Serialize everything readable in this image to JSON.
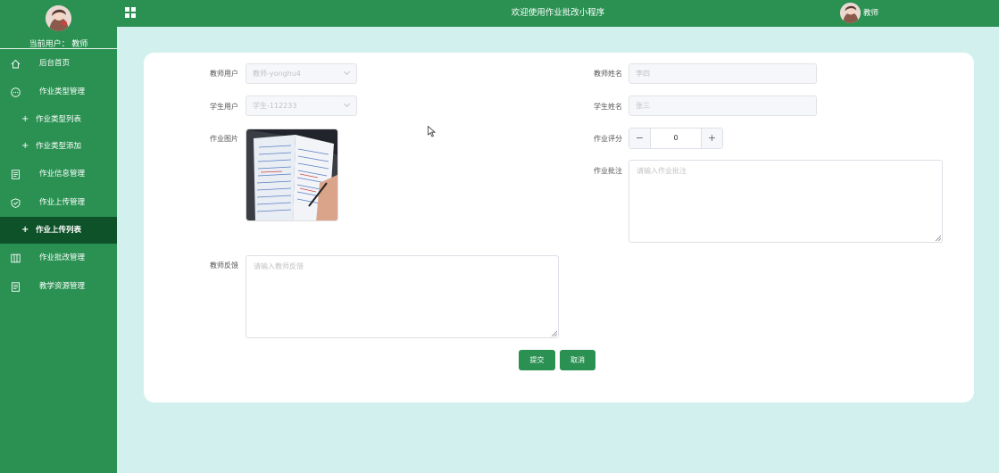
{
  "sidebar": {
    "user_label": "当前用户：  教师",
    "menu": [
      {
        "label": "后台首页",
        "icon": "home-icon",
        "type": "top"
      },
      {
        "label": "作业类型管理",
        "icon": "chat-icon",
        "type": "top"
      },
      {
        "label": "作业类型列表",
        "icon": "plus-icon",
        "type": "sub"
      },
      {
        "label": "作业类型添加",
        "icon": "plus-icon",
        "type": "sub"
      },
      {
        "label": "作业信息管理",
        "icon": "document-icon",
        "type": "top"
      },
      {
        "label": "作业上传管理",
        "icon": "shield-icon",
        "type": "top"
      },
      {
        "label": "作业上传列表",
        "icon": "plus-icon",
        "type": "sub",
        "active": true
      },
      {
        "label": "作业批改管理",
        "icon": "columns-icon",
        "type": "top"
      },
      {
        "label": "教学资源管理",
        "icon": "document-icon",
        "type": "top"
      }
    ]
  },
  "header": {
    "title": "欢迎使用作业批改小程序",
    "role": "教师",
    "menu_icon": "grid-icon"
  },
  "form": {
    "teacher_user": {
      "label": "教师用户",
      "value": "教师-yonghu4"
    },
    "student_user": {
      "label": "学生用户",
      "value": "学生-112233"
    },
    "homework_image": {
      "label": "作业图片"
    },
    "teacher_name": {
      "label": "教师姓名",
      "value": "李四"
    },
    "student_name": {
      "label": "学生姓名",
      "value": "张三"
    },
    "score": {
      "label": "作业评分",
      "value": "0"
    },
    "annotation": {
      "label": "作业批注",
      "placeholder": "请输入作业批注"
    },
    "feedback": {
      "label": "教师反馈",
      "placeholder": "请输入教师反馈"
    },
    "submit_label": "提交",
    "cancel_label": "取消"
  },
  "colors": {
    "sidebar_bg": "#2a9152",
    "active_item_bg": "#0e5229",
    "page_bg": "#d2f1ee",
    "button_bg": "#2a9152"
  }
}
